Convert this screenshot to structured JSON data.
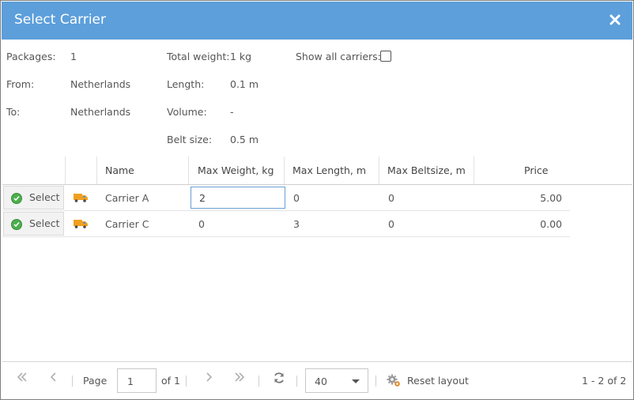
{
  "dialog": {
    "title": "Select Carrier",
    "close_icon": "close-icon"
  },
  "info": {
    "packages_label": "Packages:",
    "packages_value": "1",
    "from_label": "From:",
    "from_value": "Netherlands",
    "to_label": "To:",
    "to_value": "Netherlands",
    "total_weight_label": "Total weight:",
    "total_weight_value": "1 kg",
    "length_label": "Length:",
    "length_value": "0.1 m",
    "volume_label": "Volume:",
    "volume_value": "-",
    "belt_size_label": "Belt size:",
    "belt_size_value": "0.5 m",
    "show_all_label": "Show all carriers:",
    "show_all_checked": false
  },
  "grid": {
    "columns": [
      "Name",
      "Max Weight, kg",
      "Max Length, m",
      "Max Beltsize, m",
      "Price"
    ],
    "select_label": "Select",
    "rows": [
      {
        "name": "Carrier A",
        "max_weight": "2",
        "max_length": "0",
        "max_beltsize": "0",
        "price": "5.00"
      },
      {
        "name": "Carrier C",
        "max_weight": "0",
        "max_length": "3",
        "max_beltsize": "0",
        "price": "0.00"
      }
    ]
  },
  "pager": {
    "page_label": "Page",
    "page_value": "1",
    "of_label": "of 1",
    "page_size": "40",
    "reset_label": "Reset layout",
    "range_label": "1 - 2 of 2"
  },
  "colors": {
    "titlebar": "#5c9fdb",
    "select_ok": "#4cae4c",
    "truck": "#f0a020"
  }
}
